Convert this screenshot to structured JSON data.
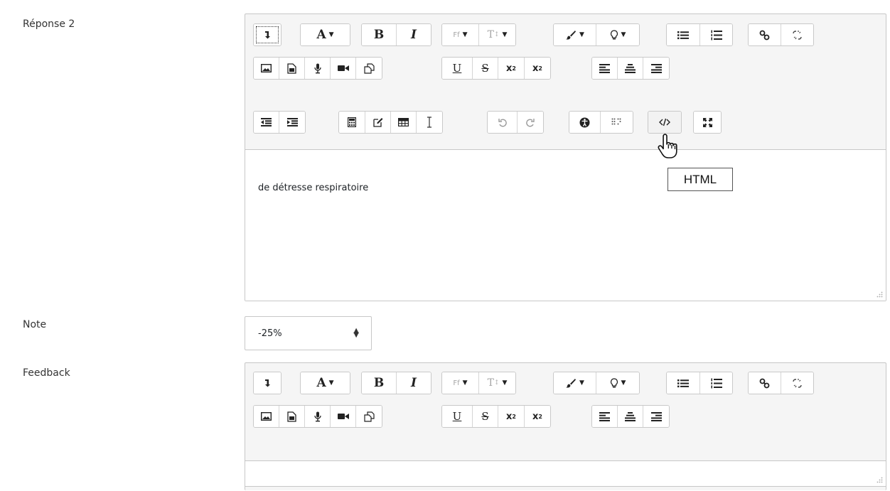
{
  "labels": {
    "answer": "Réponse 2",
    "grade": "Note",
    "feedback": "Feedback"
  },
  "answer_editor": {
    "text": "de détresse respiratoire"
  },
  "grade_select": {
    "value": "-25%"
  },
  "toolbar": {
    "font_family_label": "Ff",
    "font_size_label": "T",
    "bold_label": "B",
    "italic_label": "I",
    "underline_label": "U",
    "strike_label": "S",
    "subscript_label": "x",
    "subscript_small": "2",
    "superscript_label": "x",
    "superscript_small": "2",
    "style_label": "A"
  },
  "tooltip": {
    "text": "HTML"
  },
  "icons": {
    "collapse": "collapse-icon",
    "style": "paragraph-style-icon",
    "font_color": "brush-icon",
    "background_color": "lightbulb-icon",
    "unordered_list": "bullet-list-icon",
    "ordered_list": "numbered-list-icon",
    "link": "link-icon",
    "unlink": "unlink-icon",
    "image": "image-icon",
    "media": "media-icon",
    "audio": "microphone-icon",
    "video": "video-camera-icon",
    "files": "manage-files-icon",
    "align_left": "align-left-icon",
    "align_center": "align-center-icon",
    "align_right": "align-right-icon",
    "outdent": "outdent-icon",
    "indent": "indent-icon",
    "equation": "calculator-icon",
    "special_chars": "edit-icon",
    "table": "table-icon",
    "clear_formatting": "text-cursor-icon",
    "undo": "undo-icon",
    "redo": "redo-icon",
    "accessibility": "accessibility-icon",
    "screenreader": "screenreader-icon",
    "html": "html-code-icon",
    "fullscreen": "fullscreen-icon"
  }
}
